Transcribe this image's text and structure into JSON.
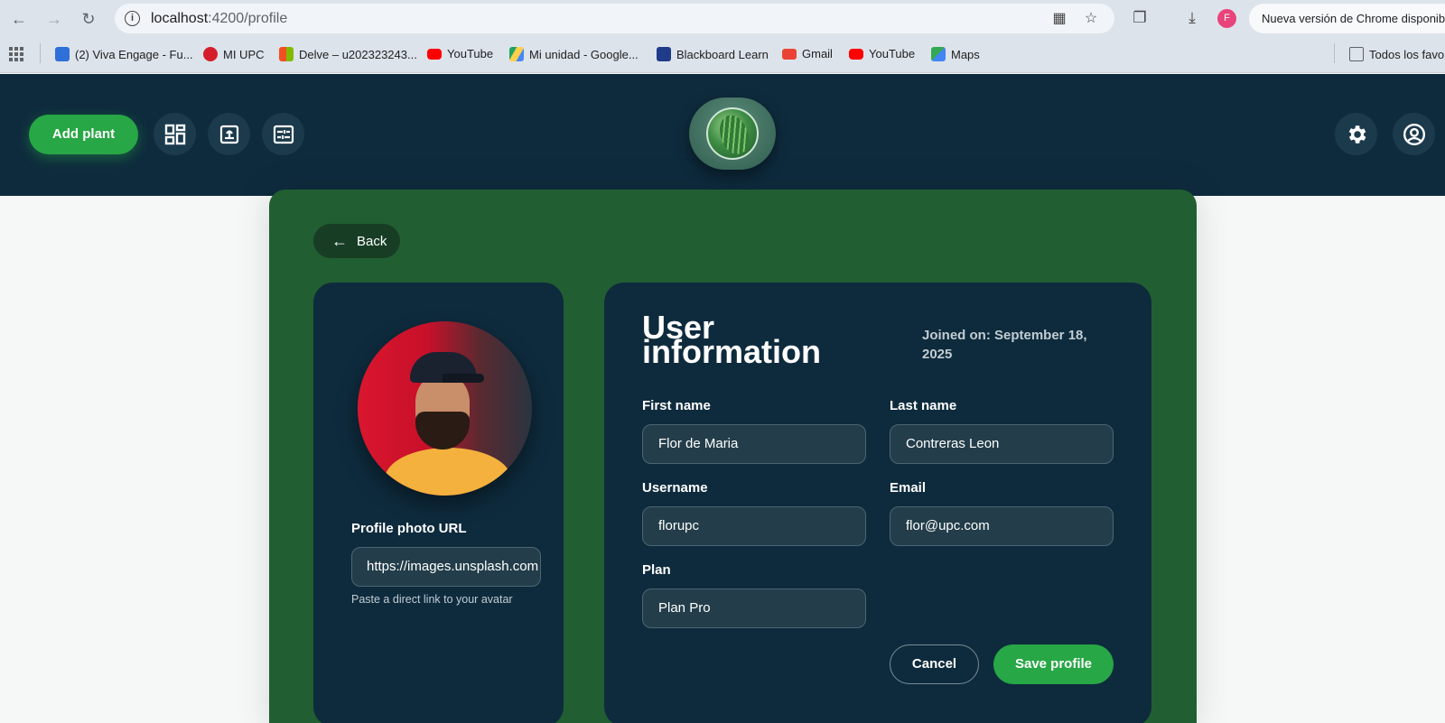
{
  "browser": {
    "url_host": "localhost",
    "url_path": ":4200/profile",
    "update_notice": "Nueva versión de Chrome disponible",
    "profile_initial": "F",
    "bookmarks": [
      {
        "label": "(2) Viva Engage - Fu...",
        "color": "#2e6fd8"
      },
      {
        "label": "MI UPC",
        "color": "#d41f2b"
      },
      {
        "label": "Delve – u202323243...",
        "color": "#f25022"
      },
      {
        "label": "YouTube",
        "color": "#ff0000"
      },
      {
        "label": "Mi unidad - Google...",
        "color": "#1fa463"
      },
      {
        "label": "Blackboard Learn",
        "color": "#1f3b8a"
      },
      {
        "label": "Gmail",
        "color": "#ea4335"
      },
      {
        "label": "YouTube",
        "color": "#ff0000"
      },
      {
        "label": "Maps",
        "color": "#34a853"
      }
    ],
    "all_bookmarks_label": "Todos los favo"
  },
  "header": {
    "add_plant_label": "Add plant",
    "nav_icons": [
      "dashboard-icon",
      "plant-pot-icon",
      "sliders-icon"
    ],
    "right_icons": [
      "settings-icon",
      "account-icon"
    ],
    "accent": "#27a745",
    "bg": "#0e2b3d"
  },
  "profile": {
    "back_label": "Back",
    "photo_url_label": "Profile photo URL",
    "photo_url_value": "https://images.unsplash.com",
    "photo_url_hint": "Paste a direct link to your avatar",
    "title": "User information",
    "joined": "Joined on: September 18, 2025",
    "fields": {
      "first_name": {
        "label": "First name",
        "value": "Flor de Maria"
      },
      "last_name": {
        "label": "Last name",
        "value": "Contreras Leon"
      },
      "username": {
        "label": "Username",
        "value": "florupc"
      },
      "email": {
        "label": "Email",
        "value": "flor@upc.com"
      },
      "plan": {
        "label": "Plan",
        "value": "Plan Pro"
      }
    },
    "cancel_label": "Cancel",
    "save_label": "Save profile"
  }
}
